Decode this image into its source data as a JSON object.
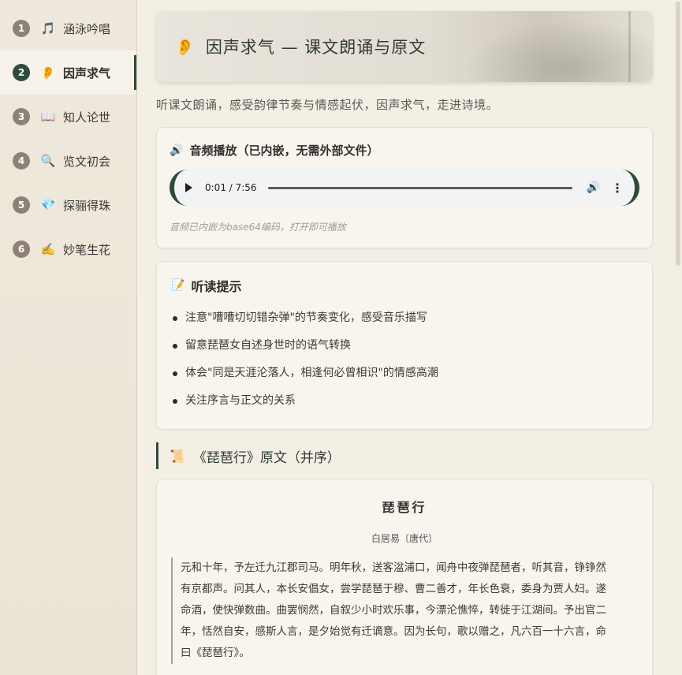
{
  "sidebar": {
    "items": [
      {
        "num": "1",
        "icon": "🎵",
        "label": "涵泳吟唱",
        "active": false
      },
      {
        "num": "2",
        "icon": "👂",
        "label": "因声求气",
        "active": true
      },
      {
        "num": "3",
        "icon": "📖",
        "label": "知人论世",
        "active": false
      },
      {
        "num": "4",
        "icon": "🔍",
        "label": "览文初会",
        "active": false
      },
      {
        "num": "5",
        "icon": "💎",
        "label": "探骊得珠",
        "active": false
      },
      {
        "num": "6",
        "icon": "✍️",
        "label": "妙笔生花",
        "active": false
      }
    ]
  },
  "hero": {
    "icon": "👂",
    "title": "因声求气 — 课文朗诵与原文"
  },
  "intro": "听课文朗诵，感受韵律节奏与情感起伏，因声求气，走进诗境。",
  "audio": {
    "icon": "🔊",
    "heading": "音频播放（已内嵌，无需外部文件）",
    "time": "0:01 / 7:56",
    "note": "音频已内嵌为base64编码，打开即可播放"
  },
  "tips": {
    "icon": "📝",
    "heading": "听读提示",
    "items": [
      "注意\"嘈嘈切切错杂弹\"的节奏变化，感受音乐描写",
      "留意琵琶女自述身世时的语气转换",
      "体会\"同是天涯沦落人，相逢何必曾相识\"的情感高潮",
      "关注序言与正文的关系"
    ]
  },
  "section": {
    "icon": "📜",
    "title": "《琵琶行》原文（并序）"
  },
  "poem": {
    "title": "琵琶行",
    "author": "白居易〔唐代〕",
    "preface": [
      "元和十年，予左迁九江郡司马。明年秋，送客湓浦口，闻舟中夜弹琵琶者，听其音，铮铮然",
      "有京都声。问其人，本长安倡女，尝学琵琶于穆、曹二善才，年长色衰，委身为贾人妇。遂",
      "命酒，使快弹数曲。曲罢悯然，自叙少小时欢乐事，今漂沦憔悴，转徙于江湖间。予出官二",
      "年，恬然自安，感斯人言，是夕始觉有迁谪意。因为长句，歌以赠之，凡六百一十六言，命",
      "曰《琵琶行》。"
    ]
  }
}
